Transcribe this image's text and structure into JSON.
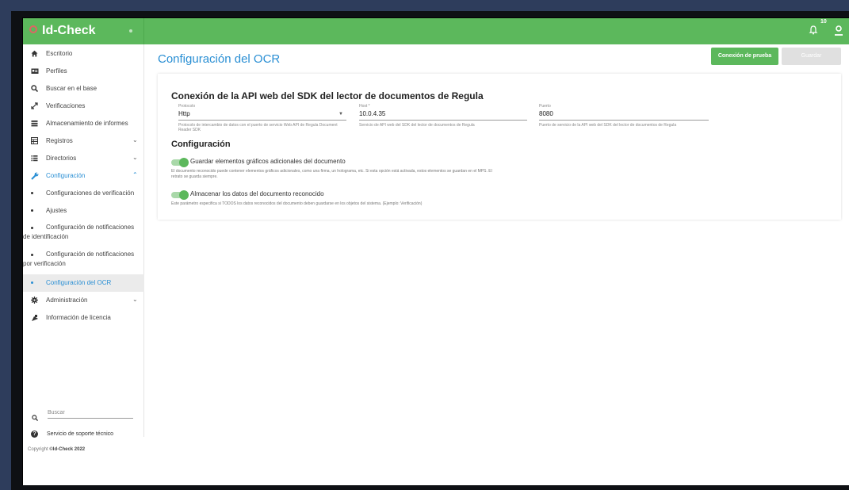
{
  "app": {
    "name": "Id-Check"
  },
  "topbar": {
    "notification_count": "10"
  },
  "sidebar": {
    "items": [
      {
        "label": "Escritorio",
        "icon": "home-icon"
      },
      {
        "label": "Perfiles",
        "icon": "id-card-icon"
      },
      {
        "label": "Buscar en el base",
        "icon": "search-icon"
      },
      {
        "label": "Verificaciones",
        "icon": "expand-icon"
      },
      {
        "label": "Almacenamiento de informes",
        "icon": "list-icon"
      },
      {
        "label": "Registros",
        "icon": "table-icon",
        "chevron": "⌄"
      },
      {
        "label": "Directorios",
        "icon": "list-bullet-icon",
        "chevron": "⌄"
      },
      {
        "label": "Configuración",
        "icon": "wrench-icon",
        "chevron": "⌃",
        "active": true
      }
    ],
    "sub_items": [
      {
        "label": "Configuraciones de verificación"
      },
      {
        "label": "Ajustes"
      },
      {
        "label": "Configuración de notificaciones de identificación"
      },
      {
        "label": "Configuración de notificaciones por verificación"
      },
      {
        "label": "Configuración del OCR",
        "selected": true
      }
    ],
    "bottom_items": [
      {
        "label": "Administración",
        "icon": "gear-icon",
        "chevron": "⌄"
      },
      {
        "label": "Información de licencia",
        "icon": "license-icon"
      }
    ],
    "search_placeholder": "Buscar",
    "support_label": "Servicio de soporte técnico",
    "copyright_prefix": "Copyright ",
    "copyright_brand": "©Id-Check 2022"
  },
  "main": {
    "title": "Configuración del OCR",
    "test_button": "Conexión de prueba",
    "save_button": "Guardar",
    "card": {
      "title": "Conexión de la API web del SDK del lector de documentos de Regula",
      "fields": [
        {
          "label": "Protocolo",
          "value": "Http",
          "help": "Protocolo de intercambio de datos con el puerto de servicio Web API de Regula Document Reader SDK"
        },
        {
          "label": "Host *",
          "value": "10.0.4.35",
          "help": "Servicio de API web del SDK del lector de documentos de Regula"
        },
        {
          "label": "Puerto",
          "value": "8080",
          "help": "Puerto de servicio de la API web del SDK del lector de documentos de Regula"
        }
      ],
      "section_title": "Configuración",
      "toggles": [
        {
          "label": "Guardar elementos gráficos adicionales del documento",
          "help": "El documento reconocido puede contener elementos gráficos adicionales, como una firma, un holograma, etc. Si esta opción está activada, estos elementos se guardan en el MPS. El retrato se guarda siempre.",
          "on": true
        },
        {
          "label": "Almacenar los datos del documento reconocido",
          "help": "Este parámetro especifica si TODOS los datos reconocidos del documento deben guardarse en los objetos del sistema. (Ejemplo: Verificación)",
          "on": true
        }
      ]
    }
  },
  "colors": {
    "brand_green": "#5cb85c",
    "accent_blue": "#2a8fd4"
  }
}
